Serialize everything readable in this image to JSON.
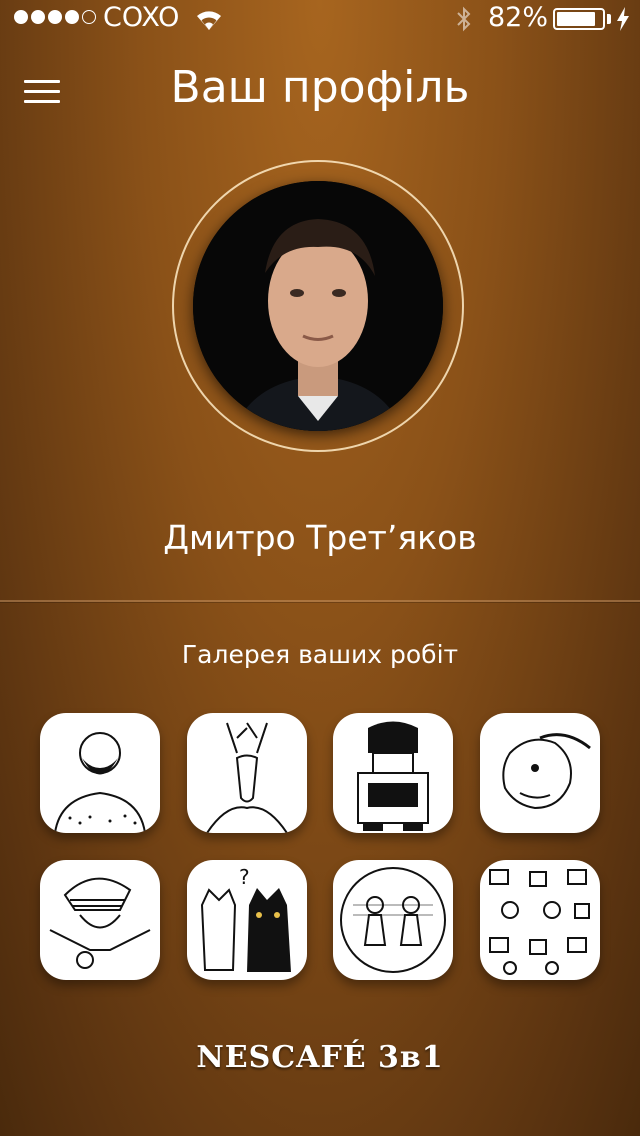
{
  "status_bar": {
    "carrier": "COXO",
    "battery_percent": "82%",
    "battery_level": 0.82,
    "signal_bars": 4,
    "signal_total": 5
  },
  "header": {
    "title": "Ваш профіль",
    "menu_icon": "hamburger-menu-icon"
  },
  "profile": {
    "name": "Дмитро Трет’яков"
  },
  "gallery": {
    "title": "Галерея ваших робіт",
    "items": [
      {
        "icon": "bearded-man-drawing"
      },
      {
        "icon": "deer-drawing"
      },
      {
        "icon": "robot-drawing"
      },
      {
        "icon": "horse-drawing"
      },
      {
        "icon": "rasta-girl-drawing"
      },
      {
        "icon": "cats-drawing"
      },
      {
        "icon": "couple-drawing"
      },
      {
        "icon": "pattern-drawing"
      }
    ]
  },
  "footer": {
    "brand": "NESCAFÉ 3в1"
  }
}
